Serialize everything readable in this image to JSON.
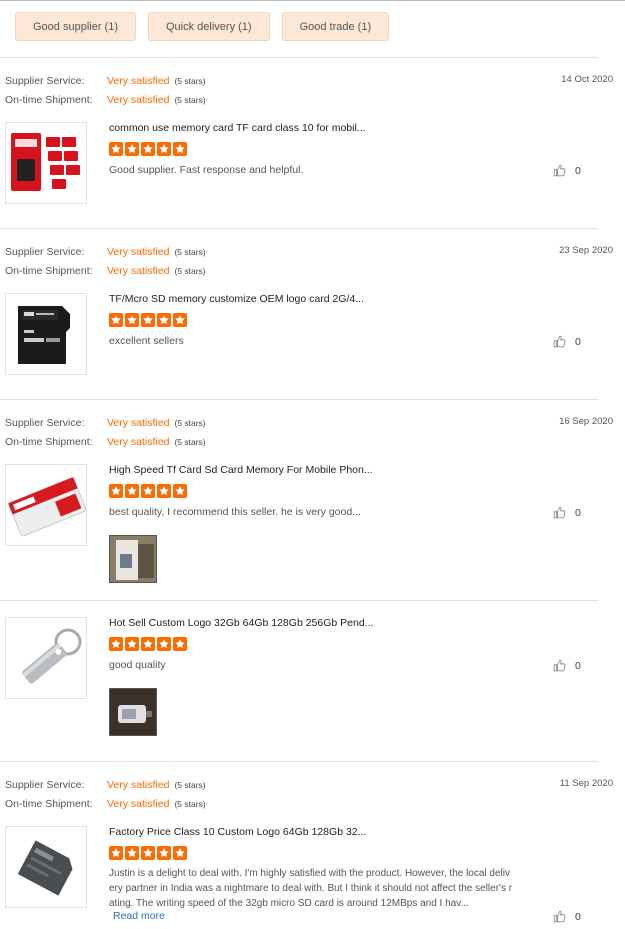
{
  "tags": [
    {
      "label": "Good supplier (1)"
    },
    {
      "label": "Quick delivery (1)"
    },
    {
      "label": "Good trade (1)"
    }
  ],
  "labels": {
    "supplier_service": "Supplier Service:",
    "ontime_shipment": "On-time Shipment:",
    "very_satisfied": "Very satisfied",
    "five_stars": "(5 stars)",
    "read_more": "Read more"
  },
  "reviews": [
    {
      "date": "14 Oct 2020",
      "product": "common use memory card TF card class 10 for mobil...",
      "comment": "Good supplier.  Fast response and helpful.",
      "likes": "0",
      "rating": 5
    },
    {
      "date": "23 Sep 2020",
      "product": "TF/Mcro SD memory customize OEM logo card 2G/4...",
      "comment": "excellent sellers",
      "likes": "0",
      "rating": 5
    },
    {
      "date": "16 Sep 2020",
      "product": "High Speed Tf Card Sd Card Memory For Mobile Phon...",
      "comment": "best quality, I recommend this seller. he is very good...",
      "likes": "0",
      "rating": 5
    },
    {
      "product": "Hot Sell Custom Logo 32Gb 64Gb 128Gb 256Gb Pend...",
      "comment": "good quality",
      "likes": "0",
      "rating": 5
    },
    {
      "date": "11 Sep 2020",
      "product": "Factory Price Class 10 Custom Logo 64Gb 128Gb 32...",
      "comment_lines": [
        "Justin is a delight to deal with. I'm highly satisfied with the product. However, the local deliv",
        "ery partner in India was a nightmare to deal with. But I think it should not affect the seller's r",
        "ating. The writing speed of the 32gb micro SD card is around 12MBps and I hav..."
      ],
      "likes": "0",
      "rating": 5
    }
  ],
  "colors": {
    "accent": "#ff6a00",
    "tag_bg": "#fde8d7",
    "link": "#2a6dc9"
  }
}
